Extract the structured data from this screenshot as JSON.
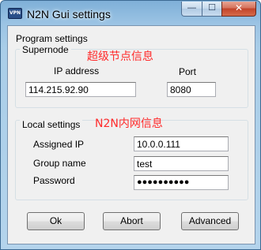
{
  "window": {
    "title": "N2N Gui settings",
    "icon_text": "VPN",
    "minimize_glyph": "—",
    "maximize_glyph": "☐",
    "close_glyph": "✕"
  },
  "program_settings": {
    "label": "Program settings"
  },
  "supernode": {
    "label": "Supernode",
    "annotation": "超级节点信息",
    "ip_label": "IP address",
    "ip_value": "114.215.92.90",
    "port_label": "Port",
    "port_value": "8080"
  },
  "local_settings": {
    "label": "Local settings",
    "annotation": "N2N内网信息",
    "assigned_ip_label": "Assigned IP",
    "assigned_ip_value": "10.0.0.111",
    "group_name_label": "Group name",
    "group_name_value": "test",
    "password_label": "Password",
    "password_value": "●●●●●●●●●●"
  },
  "buttons": {
    "ok": "Ok",
    "abort": "Abort",
    "advanced": "Advanced"
  },
  "colors": {
    "annotation": "#ff2b2b",
    "dialog_bg": "#f0f0f0",
    "titlebar": "#9cc4e4"
  }
}
